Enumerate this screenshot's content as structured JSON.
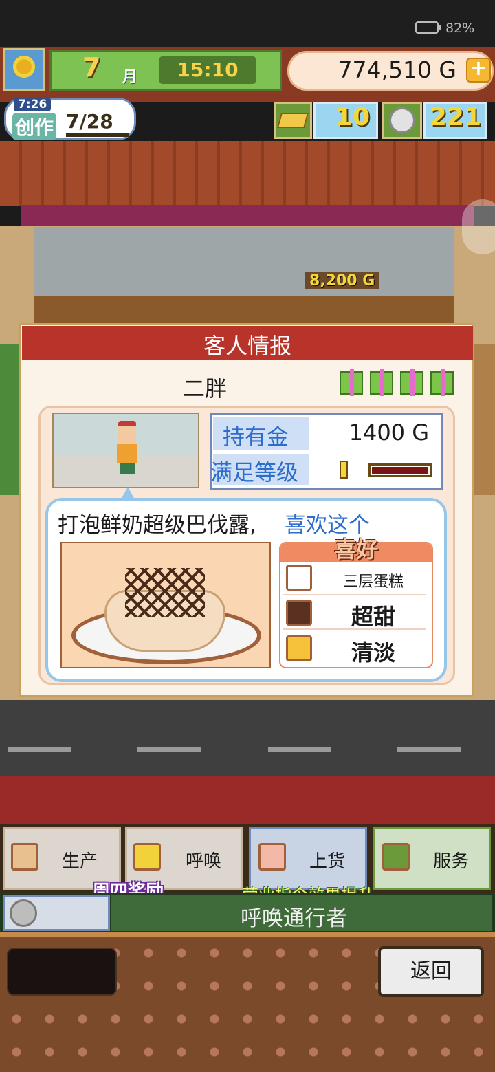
{
  "status_bar": {
    "battery": "82%"
  },
  "hud": {
    "season_icon": "sunflower-icon",
    "month": "7",
    "month_label": "月",
    "time": "15:10",
    "money": "774,510 G",
    "add_money_icon": "plus-icon"
  },
  "craft": {
    "timer": "7:26",
    "label": "创作",
    "progress": "7/28"
  },
  "resources": {
    "tickets": "10",
    "medals": "221"
  },
  "scene": {
    "sale_popup": "8,200 G"
  },
  "customer_info": {
    "title": "客人情报",
    "name": "二胖",
    "gift_count": 4,
    "money_label": "持有金",
    "money_value": "1400 G",
    "satisfaction_label": "满足等级",
    "satisfaction_level": 0.1,
    "dish_name": "打泡鲜奶超级巴伐露,",
    "dish_comment": "喜欢这个",
    "preferences_title": "喜好",
    "preferences": [
      {
        "icon": "layer-cake-icon",
        "label": "三层蛋糕"
      },
      {
        "icon": "chocolate-icon",
        "label": "超甜"
      },
      {
        "icon": "mild-flavor-icon",
        "label": "清淡"
      }
    ]
  },
  "tabs": [
    {
      "label": "生产",
      "icon": "bread-icon"
    },
    {
      "label": "呼唤",
      "icon": "megaphone-icon"
    },
    {
      "label": "上货",
      "icon": "cake-display-icon"
    },
    {
      "label": "服务",
      "icon": "coffee-cup-icon"
    }
  ],
  "banners": {
    "weekly_reward": "周四奖励",
    "command_bonus": "营业指令效果提升"
  },
  "status_message": "呼唤通行者",
  "back_label": "返回",
  "colors": {
    "header_red": "#b8332a",
    "accent_blue": "#2b6ccd",
    "money_gold": "#f4d63a"
  }
}
